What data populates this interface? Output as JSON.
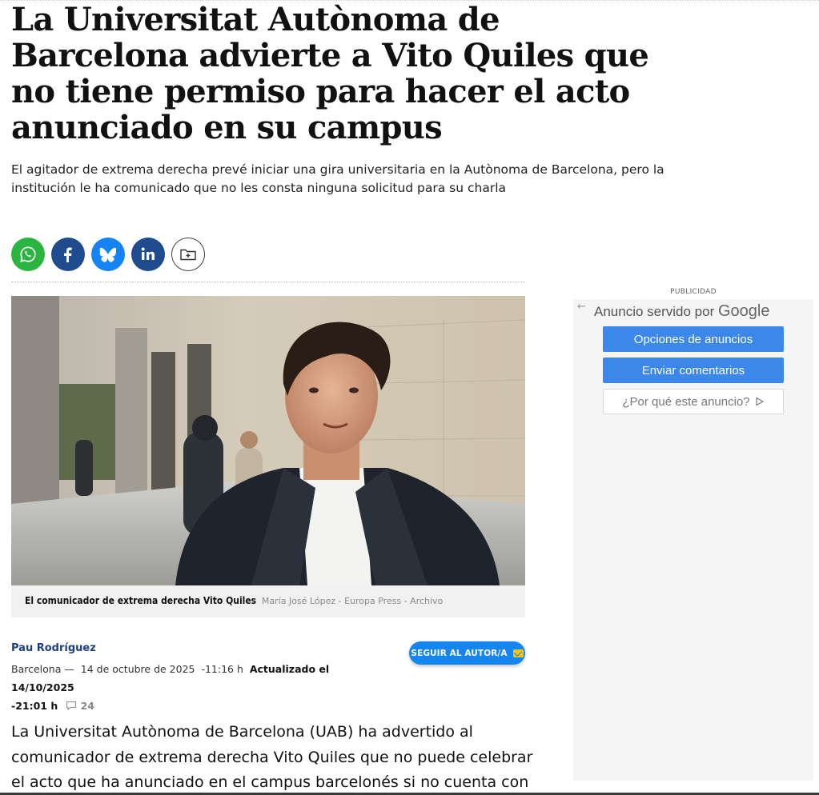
{
  "article": {
    "headline": "La Universitat Autònoma de Barcelona advierte a Vito Quiles que no tiene permiso para hacer el acto anunciado en su campus",
    "subtitle": "El agitador de extrema derecha prevé iniciar una gira universitaria en la Autònoma de Barcelona, pero la institución le ha comunicado que no les consta ninguna solicitud para su charla",
    "caption": "El comunicador de extrema derecha Vito Quiles",
    "photo_credit": "María José López - Europa Press - Archivo",
    "author": "Pau Rodríguez",
    "location": "Barcelona —",
    "date": "14 de octubre de 2025",
    "time": "-11:16 h",
    "updated_label": "Actualizado el 14/10/2025",
    "updated_time": "-21:01 h",
    "comments_count": "24",
    "follow_label": "SEGUIR AL AUTOR/A",
    "body_first_paragraph": "La Universitat Autònoma de Barcelona (UAB) ha advertido al comunicador de extrema derecha Vito Quiles que no puede celebrar el acto que ha anunciado en el campus barcelonés si no cuenta con permiso"
  },
  "share": {
    "icons": [
      "whatsapp-icon",
      "facebook-icon",
      "bluesky-icon",
      "linkedin-icon",
      "save-icon"
    ],
    "colors": {
      "whatsapp": "#2ab540",
      "facebook": "#1f4b8f",
      "bluesky": "#1583f3",
      "linkedin": "#1f4b8f"
    }
  },
  "ad": {
    "label": "PUBLICIDAD",
    "served_by": "Anuncio servido por",
    "google": "Google",
    "options_button": "Opciones de anuncios",
    "feedback_button": "Enviar comentarios",
    "why_button": "¿Por qué este anuncio?"
  },
  "colors": {
    "author": "#1c3f86",
    "follow_button": "#1585f0",
    "ad_button": "#3c87ea"
  }
}
